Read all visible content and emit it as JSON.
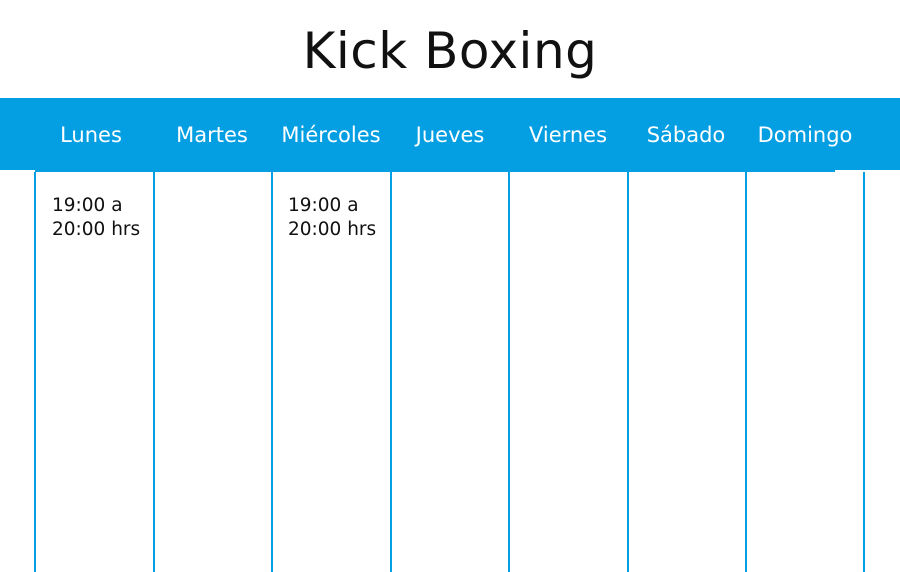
{
  "title": "Kick Boxing",
  "colors": {
    "accent": "#049fe3",
    "header_text": "#ffffff",
    "body_text": "#111111",
    "background": "#ffffff"
  },
  "days": [
    {
      "label": "Lunes",
      "slot_line1": "19:00 a",
      "slot_line2": "20:00 hrs"
    },
    {
      "label": "Martes",
      "slot_line1": "",
      "slot_line2": ""
    },
    {
      "label": "Miércoles",
      "slot_line1": "19:00 a",
      "slot_line2": "20:00 hrs"
    },
    {
      "label": "Jueves",
      "slot_line1": "",
      "slot_line2": ""
    },
    {
      "label": "Viernes",
      "slot_line1": "",
      "slot_line2": ""
    },
    {
      "label": "Sábado",
      "slot_line1": "",
      "slot_line2": ""
    },
    {
      "label": "Domingo",
      "slot_line1": "",
      "slot_line2": ""
    }
  ]
}
